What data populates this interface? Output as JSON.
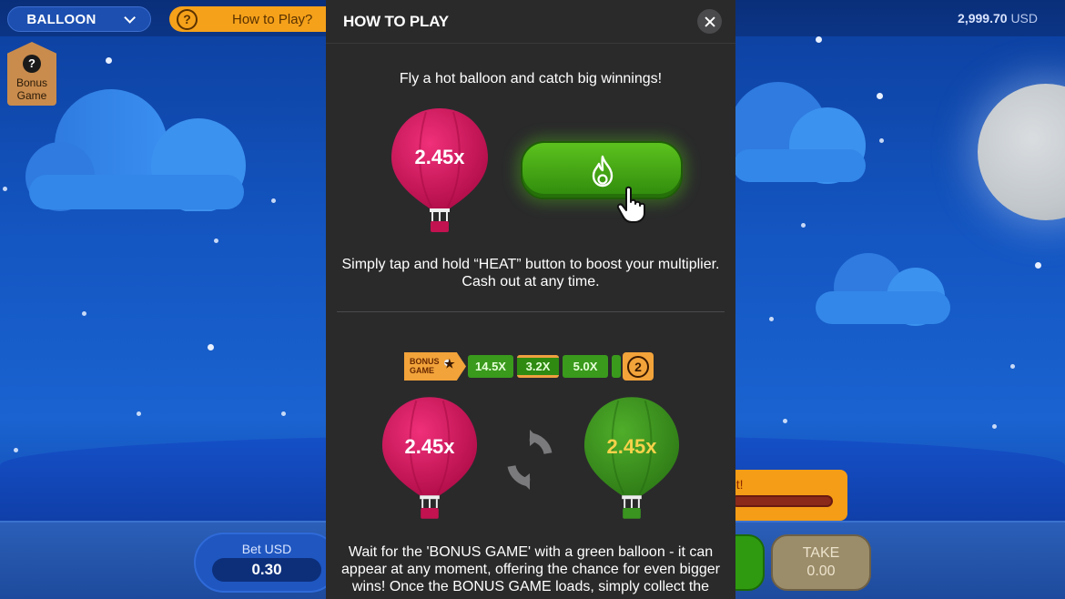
{
  "topbar": {
    "game_name": "BALLOON",
    "howto_label": "How to Play?",
    "balance_amount": "2,999.70",
    "balance_currency": "USD"
  },
  "bonus_badge": {
    "label": "Bonus Game"
  },
  "bet": {
    "label": "Bet USD",
    "value": "0.30"
  },
  "take": {
    "label": "TAKE",
    "value": "0.00"
  },
  "bonus_tile": {
    "text": "et!"
  },
  "modal": {
    "title": "HOW TO PLAY",
    "intro": "Fly a hot balloon and catch big winnings!",
    "step1_balloon_multiplier": "2.45x",
    "heat_instruction_line1": "Simply tap and hold “HEAT” button to boost your multiplier.",
    "heat_instruction_line2": "Cash out at any time.",
    "strip": {
      "bonus_label_line1": "BONUS",
      "bonus_label_line2": "GAME",
      "multipliers": [
        "14.5X",
        "3.2X",
        "5.0X"
      ],
      "count": "2"
    },
    "bonus_red_multiplier": "2.45x",
    "bonus_green_multiplier": "2.45x",
    "bonus_text_line1": "Wait for the 'BONUS GAME' with a green balloon - it can",
    "bonus_text_line2": "appear at any moment, offering the chance for even bigger",
    "bonus_text_line3": "wins! Once the BONUS GAME loads, simply collect the"
  },
  "colors": {
    "accent_orange": "#f5a11a",
    "heat_green": "#4caf1a",
    "balloon_red": "#d4145a",
    "balloon_green": "#3f9a24",
    "modal_bg": "#2a2a2b",
    "sky_blue": "#1456c2"
  },
  "icons": {
    "close": "close-icon",
    "heat": "flame-icon",
    "cursor": "hand-pointer-icon",
    "swap": "refresh-icon",
    "help": "question-icon",
    "dropdown": "chevron-down-icon"
  }
}
